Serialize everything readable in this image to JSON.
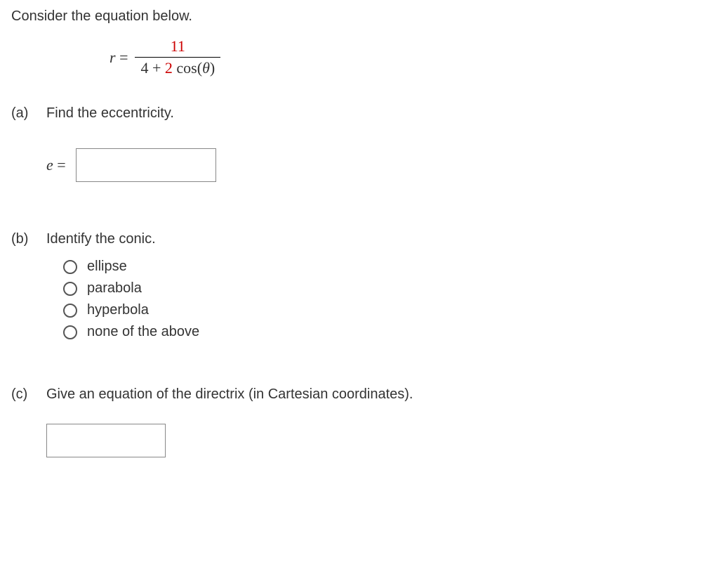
{
  "intro": "Consider the equation below.",
  "equation": {
    "lhs_var": "r",
    "equals": " = ",
    "numerator": "11",
    "den_const": "4",
    "den_plus": " + ",
    "den_coef": "2",
    "den_cos_open": " cos(",
    "den_theta": "θ",
    "den_cos_close": ")"
  },
  "parts": {
    "a": {
      "label": "(a)",
      "text": "Find the eccentricity.",
      "answer_label_var": "e",
      "answer_label_eq": " = "
    },
    "b": {
      "label": "(b)",
      "text": "Identify the conic.",
      "options": [
        "ellipse",
        "parabola",
        "hyperbola",
        "none of the above"
      ]
    },
    "c": {
      "label": "(c)",
      "text": "Give an equation of the directrix (in Cartesian coordinates)."
    }
  }
}
